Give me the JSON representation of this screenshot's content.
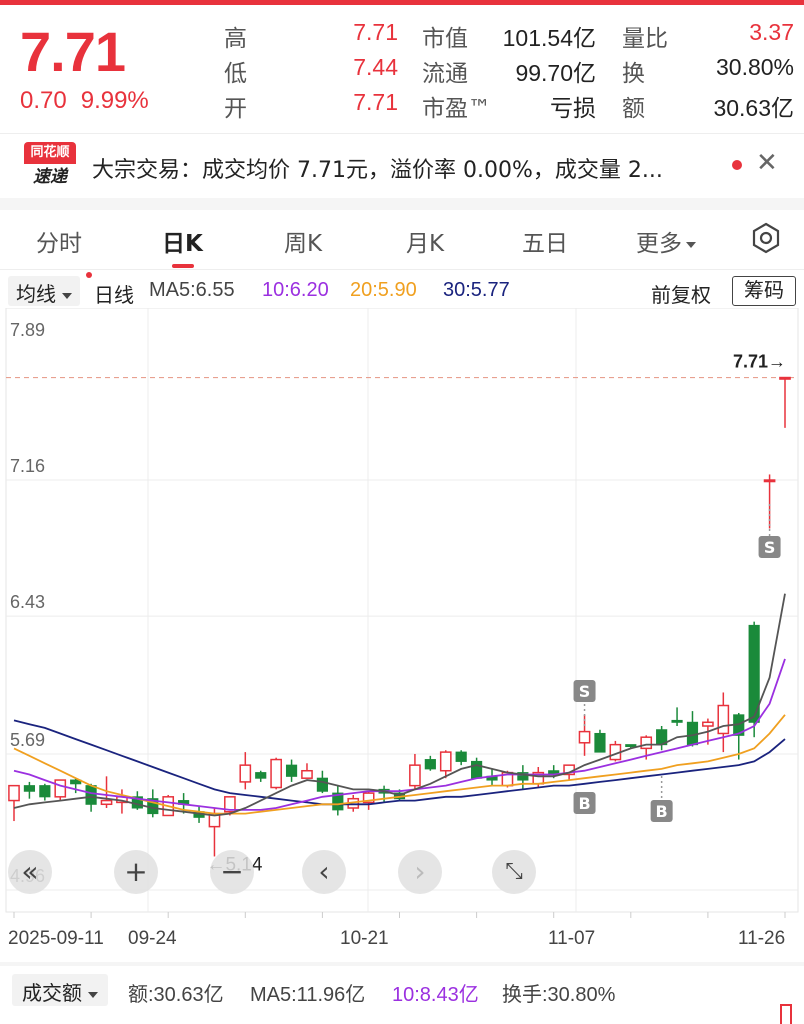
{
  "quote": {
    "price": "7.71",
    "change": "0.70",
    "change_pct": "9.99%",
    "rows": [
      {
        "l1": "高",
        "v1": "7.71",
        "l2": "市值",
        "v2": "101.54亿",
        "l3": "量比",
        "v3": "3.37"
      },
      {
        "l1": "低",
        "v1": "7.44",
        "l2": "流通",
        "v2": "99.70亿",
        "l3": "换",
        "v3": "30.80%"
      },
      {
        "l1": "开",
        "v1": "7.71",
        "l2": "市盈™",
        "v2": "亏损",
        "l3": "额",
        "v3": "30.63亿"
      }
    ]
  },
  "news": {
    "logo_top": "同花顺",
    "logo_bottom": "速递",
    "text": "大宗交易：成交均价 7.71元，溢价率 0.00%，成交量 2..."
  },
  "tabs": [
    "分时",
    "日K",
    "周K",
    "月K",
    "五日",
    "更多"
  ],
  "ma": {
    "selector": "均线",
    "period": "日线",
    "ma5": "MA5:6.55",
    "ma10": "10:6.20",
    "ma20": "20:5.90",
    "ma30": "30:5.77",
    "adjust": "前复权",
    "chips": "筹码"
  },
  "chart_data": {
    "type": "candlestick",
    "y_ticks": [
      "7.89",
      "7.16",
      "6.43",
      "5.69",
      "4.96"
    ],
    "ylim": [
      4.96,
      7.89
    ],
    "x_labels": [
      "2025-09-11",
      "09-24",
      "10-21",
      "11-07",
      "11-26"
    ],
    "last_price_marker": "7.71→",
    "low_marker": "←5.14",
    "buy_marker": "B",
    "sell_marker": "S",
    "colors": {
      "up": "#e8323c",
      "down": "#1a8a3a",
      "ma5": "#555555",
      "ma10": "#9b30e0",
      "ma20": "#f0a020",
      "ma30": "#1a237e"
    },
    "candles": [
      [
        5.44,
        5.52,
        5.33,
        5.52
      ],
      [
        5.52,
        5.54,
        5.45,
        5.49
      ],
      [
        5.52,
        5.53,
        5.44,
        5.46
      ],
      [
        5.46,
        5.55,
        5.44,
        5.55
      ],
      [
        5.55,
        5.56,
        5.48,
        5.53
      ],
      [
        5.52,
        5.53,
        5.38,
        5.42
      ],
      [
        5.42,
        5.57,
        5.4,
        5.44
      ],
      [
        5.43,
        5.5,
        5.37,
        5.46
      ],
      [
        5.46,
        5.49,
        5.39,
        5.4
      ],
      [
        5.45,
        5.5,
        5.35,
        5.37
      ],
      [
        5.36,
        5.47,
        5.36,
        5.46
      ],
      [
        5.44,
        5.48,
        5.37,
        5.42
      ],
      [
        5.38,
        5.41,
        5.32,
        5.35
      ],
      [
        5.3,
        5.4,
        5.14,
        5.37
      ],
      [
        5.38,
        5.46,
        5.36,
        5.46
      ],
      [
        5.54,
        5.7,
        5.5,
        5.63
      ],
      [
        5.59,
        5.6,
        5.54,
        5.56
      ],
      [
        5.51,
        5.67,
        5.5,
        5.66
      ],
      [
        5.63,
        5.66,
        5.54,
        5.57
      ],
      [
        5.56,
        5.64,
        5.56,
        5.6
      ],
      [
        5.56,
        5.6,
        5.48,
        5.49
      ],
      [
        5.48,
        5.52,
        5.36,
        5.39
      ],
      [
        5.4,
        5.47,
        5.38,
        5.45
      ],
      [
        5.43,
        5.49,
        5.39,
        5.48
      ],
      [
        5.5,
        5.52,
        5.43,
        5.48
      ],
      [
        5.48,
        5.5,
        5.44,
        5.45
      ],
      [
        5.52,
        5.69,
        5.5,
        5.63
      ],
      [
        5.66,
        5.68,
        5.6,
        5.61
      ],
      [
        5.6,
        5.71,
        5.56,
        5.7
      ],
      [
        5.7,
        5.71,
        5.63,
        5.65
      ],
      [
        5.65,
        5.67,
        5.56,
        5.56
      ],
      [
        5.57,
        5.61,
        5.52,
        5.55
      ],
      [
        5.52,
        5.6,
        5.51,
        5.59
      ],
      [
        5.59,
        5.63,
        5.5,
        5.55
      ],
      [
        5.53,
        5.62,
        5.51,
        5.59
      ],
      [
        5.6,
        5.63,
        5.56,
        5.58
      ],
      [
        5.58,
        5.62,
        5.55,
        5.63
      ],
      [
        5.75,
        5.9,
        5.68,
        5.81
      ],
      [
        5.8,
        5.82,
        5.7,
        5.7
      ],
      [
        5.66,
        5.76,
        5.65,
        5.74
      ],
      [
        5.74,
        5.74,
        5.72,
        5.73
      ],
      [
        5.72,
        5.79,
        5.66,
        5.78
      ],
      [
        5.82,
        5.84,
        5.71,
        5.74
      ],
      [
        5.87,
        5.94,
        5.84,
        5.86
      ],
      [
        5.86,
        5.92,
        5.73,
        5.74
      ],
      [
        5.84,
        5.88,
        5.74,
        5.86
      ],
      [
        5.8,
        6.02,
        5.7,
        5.95
      ],
      [
        5.9,
        5.91,
        5.66,
        5.79
      ],
      [
        6.38,
        6.4,
        5.78,
        5.86
      ],
      [
        7.16,
        7.19,
        6.9,
        7.16
      ],
      [
        7.71,
        7.71,
        7.44,
        7.71
      ]
    ],
    "ma5": [
      5.4,
      5.42,
      5.43,
      5.44,
      5.45,
      5.46,
      5.45,
      5.44,
      5.42,
      5.4,
      5.39,
      5.38,
      5.37,
      5.36,
      5.37,
      5.4,
      5.44,
      5.48,
      5.52,
      5.55,
      5.54,
      5.52,
      5.5,
      5.5,
      5.49,
      5.47,
      5.5,
      5.53,
      5.57,
      5.61,
      5.63,
      5.61,
      5.59,
      5.58,
      5.57,
      5.57,
      5.59,
      5.63,
      5.66,
      5.69,
      5.72,
      5.74,
      5.74,
      5.78,
      5.79,
      5.81,
      5.84,
      5.85,
      5.89,
      6.1,
      6.55
    ],
    "ma10": [
      5.6,
      5.58,
      5.55,
      5.52,
      5.5,
      5.48,
      5.47,
      5.46,
      5.45,
      5.44,
      5.43,
      5.42,
      5.41,
      5.4,
      5.39,
      5.39,
      5.39,
      5.4,
      5.42,
      5.44,
      5.46,
      5.47,
      5.48,
      5.49,
      5.49,
      5.49,
      5.5,
      5.51,
      5.52,
      5.54,
      5.56,
      5.57,
      5.58,
      5.58,
      5.58,
      5.58,
      5.59,
      5.6,
      5.62,
      5.64,
      5.66,
      5.68,
      5.7,
      5.72,
      5.74,
      5.76,
      5.78,
      5.8,
      5.84,
      5.96,
      6.2
    ],
    "ma20": [
      5.72,
      5.68,
      5.64,
      5.6,
      5.56,
      5.52,
      5.49,
      5.47,
      5.45,
      5.43,
      5.41,
      5.39,
      5.38,
      5.37,
      5.37,
      5.37,
      5.38,
      5.39,
      5.4,
      5.41,
      5.42,
      5.42,
      5.43,
      5.44,
      5.45,
      5.46,
      5.47,
      5.48,
      5.49,
      5.5,
      5.51,
      5.52,
      5.52,
      5.53,
      5.53,
      5.54,
      5.55,
      5.56,
      5.57,
      5.58,
      5.59,
      5.6,
      5.61,
      5.63,
      5.64,
      5.65,
      5.67,
      5.69,
      5.72,
      5.8,
      5.9
    ],
    "ma30": [
      5.87,
      5.85,
      5.83,
      5.8,
      5.77,
      5.74,
      5.71,
      5.68,
      5.65,
      5.62,
      5.59,
      5.56,
      5.53,
      5.5,
      5.48,
      5.47,
      5.46,
      5.45,
      5.44,
      5.43,
      5.42,
      5.42,
      5.42,
      5.42,
      5.43,
      5.44,
      5.44,
      5.45,
      5.46,
      5.46,
      5.47,
      5.48,
      5.49,
      5.5,
      5.51,
      5.52,
      5.52,
      5.53,
      5.54,
      5.55,
      5.56,
      5.57,
      5.58,
      5.59,
      5.6,
      5.61,
      5.62,
      5.63,
      5.65,
      5.7,
      5.77
    ]
  },
  "volume": {
    "selector": "成交额",
    "amount": "额:30.63亿",
    "ma5": "MA5:11.96亿",
    "ma10": "10:8.43亿",
    "turnover": "换手:30.80%"
  }
}
